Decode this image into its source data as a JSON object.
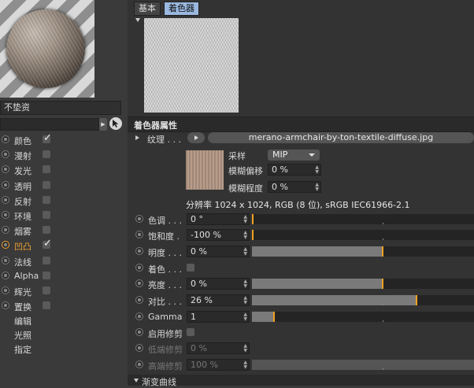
{
  "material": {
    "name": "不垫资",
    "channels": [
      {
        "label": "颜色",
        "checked": true
      },
      {
        "label": "漫射",
        "checked": false
      },
      {
        "label": "发光",
        "checked": false
      },
      {
        "label": "透明",
        "checked": false
      },
      {
        "label": "反射",
        "checked": false
      },
      {
        "label": "环境",
        "checked": false
      },
      {
        "label": "烟雾",
        "checked": false
      },
      {
        "label": "凹凸",
        "checked": true,
        "active": true
      },
      {
        "label": "法线",
        "checked": false
      },
      {
        "label": "Alpha",
        "checked": false
      },
      {
        "label": "辉光",
        "checked": false
      },
      {
        "label": "置换",
        "checked": false
      }
    ],
    "extra_items": [
      "编辑",
      "光照",
      "指定"
    ]
  },
  "tabs": [
    {
      "label": "基本",
      "selected": false
    },
    {
      "label": "着色器",
      "selected": true
    }
  ],
  "section_title": "着色器属性",
  "texture": {
    "label": "纹理 . . .",
    "file": "merano-armchair-by-ton-textile-diffuse.jpg",
    "sample_label": "采样",
    "sample_value": "MIP",
    "blur_offset_label": "模糊偏移",
    "blur_offset_value": "0 %",
    "blur_degree_label": "模糊程度",
    "blur_degree_value": "0 %",
    "resolution": "分辨率 1024 x 1024, RGB (8 位), sRGB IEC61966-2.1"
  },
  "properties": [
    {
      "label": "色调 . . .",
      "value": "0 °",
      "type": "slider",
      "level": 0
    },
    {
      "label": "饱和度 .",
      "value": "-100 %",
      "type": "slider",
      "level": 0
    },
    {
      "label": "明度 . . .",
      "value": "0 %",
      "type": "slider",
      "level": 0.59
    },
    {
      "label": "着色 . . .",
      "type": "checkbox"
    },
    {
      "label": "亮度 . . .",
      "value": "0 %",
      "type": "slider",
      "level": 0.59
    },
    {
      "label": "对比 . . .",
      "value": "26 %",
      "type": "slider",
      "level": 0.74
    },
    {
      "label": "Gamma",
      "value": "1",
      "type": "slider",
      "level": 0.1
    },
    {
      "label": "启用修剪",
      "type": "checkbox"
    },
    {
      "label": "低端修剪",
      "value": "0 %",
      "type": "none",
      "dim": true
    },
    {
      "label": "高端修剪",
      "value": "100 %",
      "type": "slider",
      "level": 1,
      "dim": true
    }
  ],
  "curve_section": "渐变曲线",
  "colors": {
    "accent": "#f0a020",
    "tab_selected": "#9ab8e0",
    "active_channel": "#f0a030"
  }
}
